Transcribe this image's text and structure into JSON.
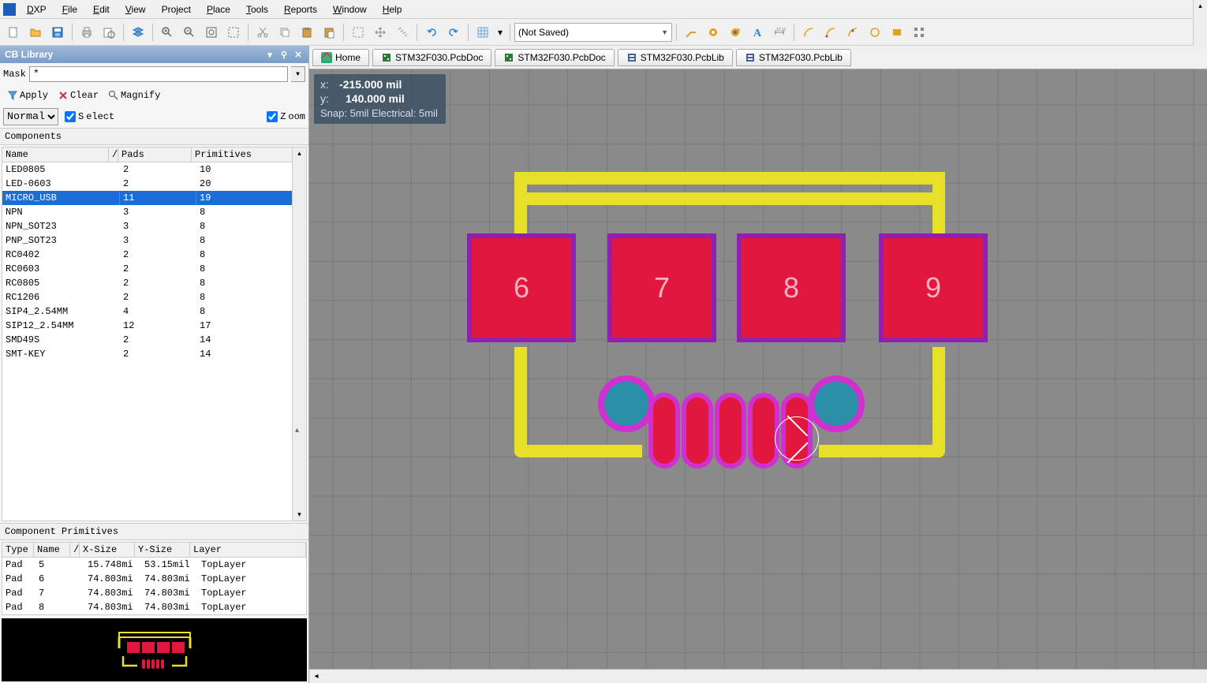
{
  "menu": {
    "app": "DXP",
    "items": [
      "File",
      "Edit",
      "View",
      "Project",
      "Place",
      "Tools",
      "Reports",
      "Window",
      "Help"
    ]
  },
  "toolbar": {
    "save_state": "(Not Saved)"
  },
  "panel": {
    "title": "CB Library",
    "mask_label": "Mask",
    "mask_value": "*",
    "apply": "Apply",
    "clear": "Clear",
    "magnify": "Magnify",
    "normal": "Normal",
    "select": "Select",
    "zoom": "Zoom"
  },
  "components": {
    "title": "Components",
    "columns": [
      "Name",
      "/",
      "Pads",
      "Primitives"
    ],
    "rows": [
      {
        "name": "LED0805",
        "pads": "2",
        "prims": "10"
      },
      {
        "name": "LED-0603",
        "pads": "2",
        "prims": "20"
      },
      {
        "name": "MICRO_USB",
        "pads": "11",
        "prims": "19",
        "selected": true
      },
      {
        "name": "NPN",
        "pads": "3",
        "prims": "8"
      },
      {
        "name": "NPN_SOT23",
        "pads": "3",
        "prims": "8"
      },
      {
        "name": "PNP_SOT23",
        "pads": "3",
        "prims": "8"
      },
      {
        "name": "RC0402",
        "pads": "2",
        "prims": "8"
      },
      {
        "name": "RC0603",
        "pads": "2",
        "prims": "8"
      },
      {
        "name": "RC0805",
        "pads": "2",
        "prims": "8"
      },
      {
        "name": "RC1206",
        "pads": "2",
        "prims": "8"
      },
      {
        "name": "SIP4_2.54MM",
        "pads": "4",
        "prims": "8"
      },
      {
        "name": "SIP12_2.54MM",
        "pads": "12",
        "prims": "17"
      },
      {
        "name": "SMD49S",
        "pads": "2",
        "prims": "14"
      },
      {
        "name": "SMT-KEY",
        "pads": "2",
        "prims": "14"
      }
    ]
  },
  "primitives": {
    "title": "Component Primitives",
    "columns": [
      "Type",
      "Name",
      "/",
      "X-Size",
      "Y-Size",
      "Layer"
    ],
    "rows": [
      {
        "type": "Pad",
        "name": "5",
        "xs": "15.748mi",
        "ys": "53.15mil",
        "layer": "TopLayer"
      },
      {
        "type": "Pad",
        "name": "6",
        "xs": "74.803mi",
        "ys": "74.803mi",
        "layer": "TopLayer"
      },
      {
        "type": "Pad",
        "name": "7",
        "xs": "74.803mi",
        "ys": "74.803mi",
        "layer": "TopLayer"
      },
      {
        "type": "Pad",
        "name": "8",
        "xs": "74.803mi",
        "ys": "74.803mi",
        "layer": "TopLayer"
      }
    ]
  },
  "tabs": [
    {
      "icon": "home",
      "label": "Home"
    },
    {
      "icon": "pcbdoc",
      "label": "STM32F030.PcbDoc"
    },
    {
      "icon": "pcbdoc",
      "label": "STM32F030.PcbDoc"
    },
    {
      "icon": "pcblib",
      "label": "STM32F030.PcbLib"
    },
    {
      "icon": "pcblib",
      "label": "STM32F030.PcbLib"
    }
  ],
  "coords": {
    "x_label": "x:",
    "x_value": "-215.000  mil",
    "y_label": "y:",
    "y_value": "140.000  mil",
    "snap": "Snap: 5mil Electrical: 5mil"
  },
  "pads": {
    "p6": "6",
    "p7": "7",
    "p8": "8",
    "p9": "9"
  }
}
